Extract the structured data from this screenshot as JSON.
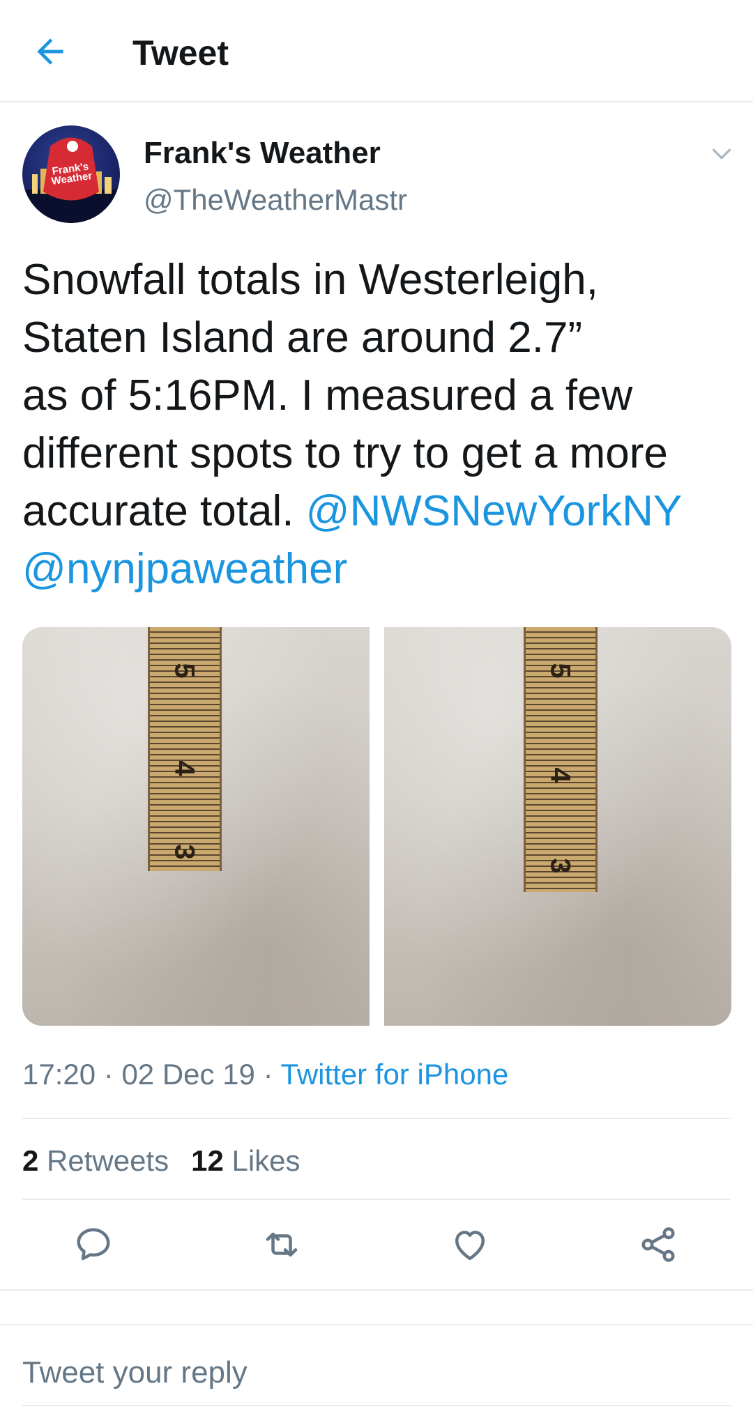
{
  "header": {
    "title": "Tweet"
  },
  "author": {
    "name": "Frank's Weather",
    "handle": "@TheWeatherMastr",
    "avatar_text": "Frank's Weather"
  },
  "tweet": {
    "line1": "Snowfall totals in Westerleigh,",
    "line2": "Staten Island are around 2.7”",
    "line3": "as of 5:16PM. I measured a few",
    "line4": "different spots to try to get a more",
    "line5_text": "accurate total. ",
    "mention1": "@NWSNewYorkNY",
    "mention2": "@nynjpaweather"
  },
  "photos": [
    {
      "ruler_marks": [
        "5",
        "4",
        "3"
      ]
    },
    {
      "ruler_marks": [
        "5",
        "4",
        "3"
      ]
    }
  ],
  "meta": {
    "time": "17:20",
    "sep1": " · ",
    "date": "02 Dec 19",
    "sep2": " · ",
    "source": "Twitter for iPhone"
  },
  "stats": {
    "retweets_count": "2",
    "retweets_label": " Retweets",
    "likes_count": "12",
    "likes_label": " Likes"
  },
  "reply": {
    "placeholder": "Tweet your reply"
  },
  "colors": {
    "accent": "#1b95e0",
    "secondary_text": "#657786",
    "divider": "#e6ecf0"
  },
  "icons": {
    "back": "arrow-left-icon",
    "more": "chevron-down-icon",
    "reply": "speech-bubble-icon",
    "retweet": "retweet-icon",
    "like": "heart-icon",
    "share": "share-icon"
  }
}
